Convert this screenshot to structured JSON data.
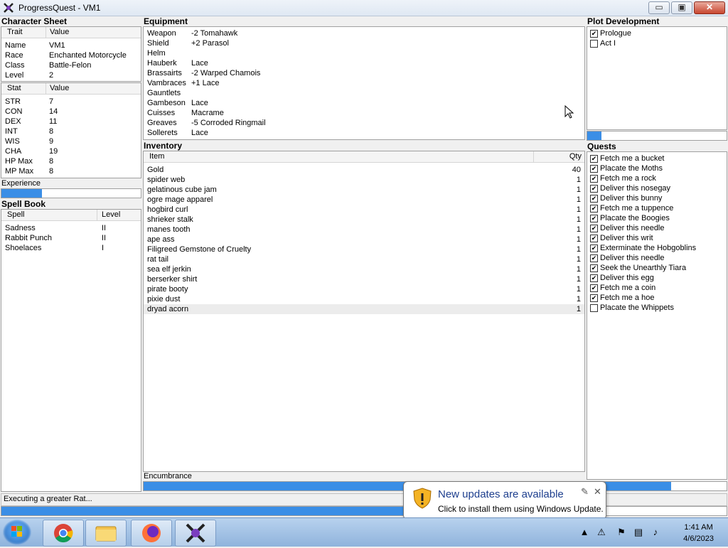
{
  "window": {
    "title": "ProgressQuest - VM1",
    "btn_min": "▭",
    "btn_max": "▣",
    "btn_close": "✕"
  },
  "character_sheet": {
    "heading": "Character Sheet",
    "traits_header": {
      "col1": "Trait",
      "col2": "Value"
    },
    "traits": [
      {
        "k": "Name",
        "v": "VM1"
      },
      {
        "k": "Race",
        "v": "Enchanted Motorcycle"
      },
      {
        "k": "Class",
        "v": "Battle-Felon"
      },
      {
        "k": "Level",
        "v": "2"
      }
    ],
    "stats_header": {
      "col1": "Stat",
      "col2": "Value"
    },
    "stats": [
      {
        "k": "STR",
        "v": "7"
      },
      {
        "k": "CON",
        "v": "14"
      },
      {
        "k": "DEX",
        "v": "11"
      },
      {
        "k": "INT",
        "v": "8"
      },
      {
        "k": "WIS",
        "v": "9"
      },
      {
        "k": "CHA",
        "v": "19"
      },
      {
        "k": "HP Max",
        "v": "8"
      },
      {
        "k": "MP Max",
        "v": "8"
      }
    ],
    "experience_label": "Experience",
    "experience_progress": 0.29
  },
  "spell_book": {
    "heading": "Spell Book",
    "header": {
      "col1": "Spell",
      "col2": "Level"
    },
    "spells": [
      {
        "k": "Sadness",
        "v": "II"
      },
      {
        "k": "Rabbit Punch",
        "v": "II"
      },
      {
        "k": "Shoelaces",
        "v": "I"
      }
    ]
  },
  "equipment": {
    "heading": "Equipment",
    "items": [
      {
        "k": "Weapon",
        "v": "-2 Tomahawk"
      },
      {
        "k": "Shield",
        "v": "+2 Parasol"
      },
      {
        "k": "Helm",
        "v": ""
      },
      {
        "k": "Hauberk",
        "v": "Lace"
      },
      {
        "k": "Brassairts",
        "v": "-2 Warped Chamois"
      },
      {
        "k": "Vambraces",
        "v": "+1 Lace"
      },
      {
        "k": "Gauntlets",
        "v": ""
      },
      {
        "k": "Gambeson",
        "v": "Lace"
      },
      {
        "k": "Cuisses",
        "v": "Macrame"
      },
      {
        "k": "Greaves",
        "v": "-5 Corroded Ringmail"
      },
      {
        "k": "Sollerets",
        "v": "Lace"
      }
    ]
  },
  "inventory": {
    "heading": "Inventory",
    "header": {
      "item": "Item",
      "qty": "Qty"
    },
    "items": [
      {
        "k": "Gold",
        "v": "40"
      },
      {
        "k": "spider web",
        "v": "1"
      },
      {
        "k": "gelatinous cube jam",
        "v": "1"
      },
      {
        "k": "ogre mage apparel",
        "v": "1"
      },
      {
        "k": "hogbird curl",
        "v": "1"
      },
      {
        "k": "shrieker stalk",
        "v": "1"
      },
      {
        "k": "manes tooth",
        "v": "1"
      },
      {
        "k": "ape ass",
        "v": "1"
      },
      {
        "k": "Filigreed Gemstone of Cruelty",
        "v": "1"
      },
      {
        "k": "rat tail",
        "v": "1"
      },
      {
        "k": "sea elf jerkin",
        "v": "1"
      },
      {
        "k": "berserker shirt",
        "v": "1"
      },
      {
        "k": "pirate booty",
        "v": "1"
      },
      {
        "k": "pixie dust",
        "v": "1"
      },
      {
        "k": "dryad acorn",
        "v": "1"
      }
    ],
    "encumbrance_label": "Encumbrance",
    "encumbrance_progress": 0.86
  },
  "plot": {
    "heading": "Plot Development",
    "acts": [
      {
        "label": "Prologue",
        "checked": true,
        "mark": "✔"
      },
      {
        "label": "Act I",
        "checked": false,
        "mark": ""
      }
    ],
    "progress": 0.1
  },
  "quests": {
    "heading": "Quests",
    "items": [
      {
        "label": "Fetch me a bucket",
        "mark": "✔"
      },
      {
        "label": "Placate the Moths",
        "mark": "✔"
      },
      {
        "label": "Fetch me a rock",
        "mark": "✔"
      },
      {
        "label": "Deliver this nosegay",
        "mark": "✔"
      },
      {
        "label": "Deliver this bunny",
        "mark": "✔"
      },
      {
        "label": "Fetch me a tuppence",
        "mark": "✔"
      },
      {
        "label": "Placate the Boogies",
        "mark": "✔"
      },
      {
        "label": "Deliver this needle",
        "mark": "✔"
      },
      {
        "label": "Deliver this writ",
        "mark": "✔"
      },
      {
        "label": "Exterminate the Hobgoblins",
        "mark": "✔"
      },
      {
        "label": "Deliver this needle",
        "mark": "✔"
      },
      {
        "label": "Seek the Unearthly Tiara",
        "mark": "✔"
      },
      {
        "label": "Deliver this egg",
        "mark": "✔"
      },
      {
        "label": "Fetch me a coin",
        "mark": "✔"
      },
      {
        "label": "Fetch me a hoe",
        "mark": "✔"
      },
      {
        "label": "Placate the Whippets",
        "mark": ""
      }
    ]
  },
  "status": {
    "text": "Executing a greater Rat...",
    "progress": 0.56
  },
  "notification": {
    "title": "New updates are available",
    "body": "Click to install them using Windows Update.",
    "pin": "✎",
    "close": "✕"
  },
  "taskbar": {
    "time": "1:41 AM",
    "date": "4/6/2023",
    "apps": [
      "chrome-icon",
      "file-explorer-icon",
      "firefox-icon",
      "progressquest-icon"
    ]
  },
  "colors": {
    "accent": "#3a8ee6",
    "title_blue": "#1e3f8e"
  }
}
